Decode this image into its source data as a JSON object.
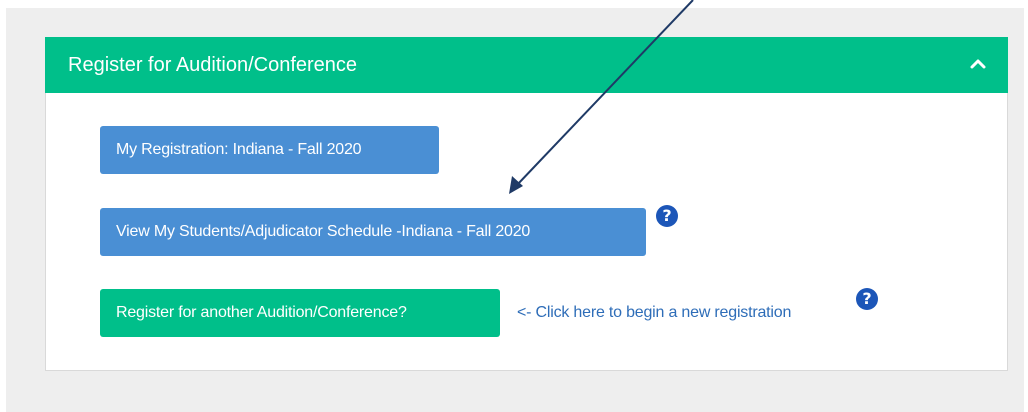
{
  "panel": {
    "title": "Register for Audition/Conference",
    "collapse_icon": "chevron-up-icon"
  },
  "buttons": {
    "my_registration": "My Registration: Indiana - Fall 2020",
    "view_schedule": "View My Students/Adjudicator Schedule -Indiana - Fall 2020",
    "register_another": "Register for another Audition/Conference?"
  },
  "help_icon": {
    "glyph": "?",
    "icon": "question-circle-icon"
  },
  "new_registration_link": "<- Click here to begin a new registration",
  "colors": {
    "header_green": "#00bf8a",
    "button_blue": "#4a8fd4",
    "button_green": "#00bf8a",
    "help_icon_blue": "#1c56b8",
    "link_blue": "#2e6db8",
    "annotation_arrow": "#1f3a66"
  }
}
